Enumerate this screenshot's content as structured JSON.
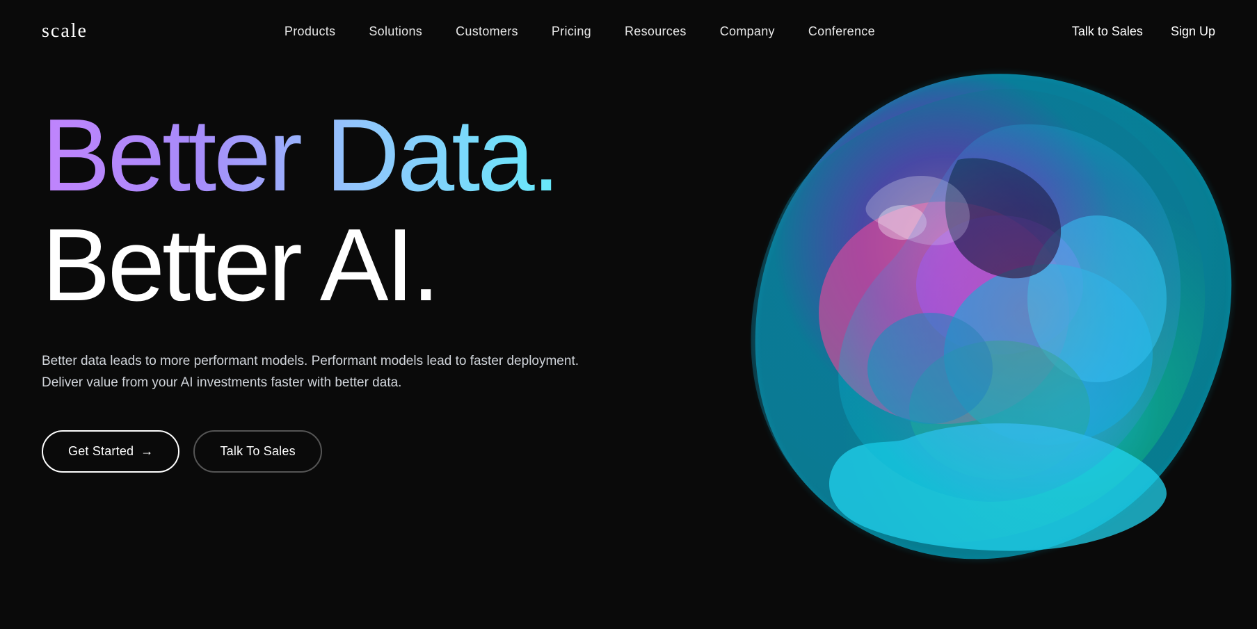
{
  "brand": {
    "logo": "scale"
  },
  "nav": {
    "links": [
      {
        "label": "Products",
        "href": "#"
      },
      {
        "label": "Solutions",
        "href": "#"
      },
      {
        "label": "Customers",
        "href": "#"
      },
      {
        "label": "Pricing",
        "href": "#"
      },
      {
        "label": "Resources",
        "href": "#"
      },
      {
        "label": "Company",
        "href": "#"
      },
      {
        "label": "Conference",
        "href": "#"
      }
    ],
    "actions": [
      {
        "label": "Talk to Sales",
        "href": "#"
      },
      {
        "label": "Sign Up",
        "href": "#"
      }
    ]
  },
  "hero": {
    "headline_line1": "Better Data.",
    "headline_line2": "Better AI.",
    "subtitle": "Better data leads to more performant models. Performant models lead to faster deployment. Deliver value from your AI investments faster with better data.",
    "btn_primary": "Get Started",
    "btn_primary_icon": "→",
    "btn_secondary": "Talk To Sales"
  }
}
